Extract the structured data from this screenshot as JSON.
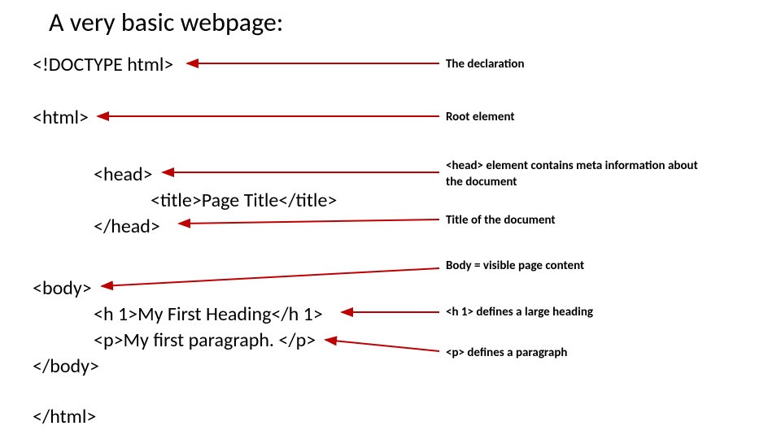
{
  "title": "A very basic webpage:",
  "code": {
    "doctype": "<!DOCTYPE html>",
    "htmlOpen": "<html>",
    "headOpen": "<head>",
    "titleLine": "<title>Page Title</title>",
    "headClose": "</head>",
    "bodyOpen": "<body>",
    "h1Line": "<h 1>My First Heading</h 1>",
    "pLine": "<p>My first paragraph. </p>",
    "bodyClose": "</body>",
    "htmlClose": "</html>"
  },
  "annotations": {
    "declaration": "The declaration",
    "root": "Root element",
    "head": "<head> element contains meta information about the document",
    "titleNote": "Title of the document",
    "bodyNote": "Body = visible page content",
    "h1Note": "<h 1> defines a large heading",
    "pNote": "<p> defines a paragraph"
  }
}
